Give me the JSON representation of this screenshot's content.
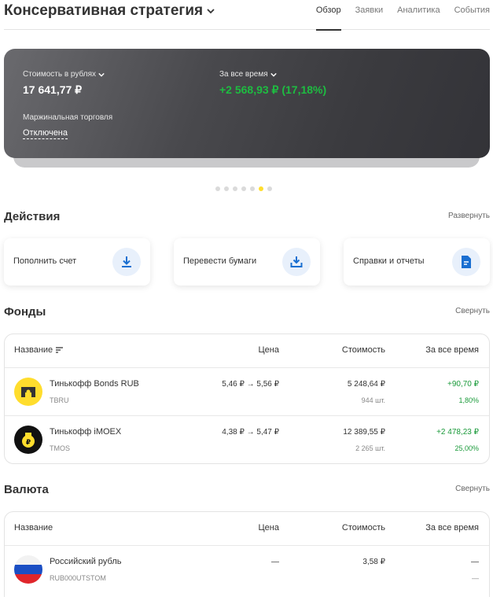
{
  "header": {
    "title": "Консервативная стратегия",
    "tabs": [
      {
        "label": "Обзор",
        "active": true
      },
      {
        "label": "Заявки",
        "active": false
      },
      {
        "label": "Аналитика",
        "active": false
      },
      {
        "label": "События",
        "active": false
      }
    ]
  },
  "summary": {
    "value_label": "Стоимость в рублях",
    "value": "17 641,77 ₽",
    "period_label": "За все время",
    "change": "+2 568,93 ₽ (17,18%)",
    "margin_label": "Маржинальная торговля",
    "margin_status": "Отключена",
    "carousel_active_index": 5,
    "carousel_count": 7
  },
  "actions": {
    "title": "Действия",
    "toggle_label": "Развернуть",
    "items": [
      {
        "label": "Пополнить счет",
        "icon": "download-icon"
      },
      {
        "label": "Перевести бумаги",
        "icon": "transfer-icon"
      },
      {
        "label": "Справки и отчеты",
        "icon": "document-icon"
      }
    ]
  },
  "funds": {
    "title": "Фонды",
    "toggle_label": "Свернуть",
    "columns": {
      "name": "Название",
      "price": "Цена",
      "value": "Стоимость",
      "total": "За все время"
    },
    "rows": [
      {
        "name": "Тинькофф Bonds RUB",
        "ticker": "TBRU",
        "price": "5,46 ₽ → 5,56 ₽",
        "value": "5 248,64 ₽",
        "qty": "944 шт.",
        "change": "+90,70 ₽",
        "change_pct": "1,80%"
      },
      {
        "name": "Тинькофф iMOEX",
        "ticker": "TMOS",
        "price": "4,38 ₽ → 5,47 ₽",
        "value": "12 389,55 ₽",
        "qty": "2 265 шт.",
        "change": "+2 478,23 ₽",
        "change_pct": "25,00%"
      }
    ]
  },
  "currency": {
    "title": "Валюта",
    "toggle_label": "Свернуть",
    "columns": {
      "name": "Название",
      "price": "Цена",
      "value": "Стоимость",
      "total": "За все время"
    },
    "rows": [
      {
        "name": "Российский рубль",
        "ticker": "RUB000UTSTOM",
        "price": "—",
        "value": "3,58 ₽",
        "change": "—",
        "change_pct": "—"
      }
    ]
  },
  "colors": {
    "accent": "#ffdd2d",
    "positive": "#1a9a3a",
    "card_positive": "#1ebc41",
    "icon_blue": "#1a6fd1"
  }
}
